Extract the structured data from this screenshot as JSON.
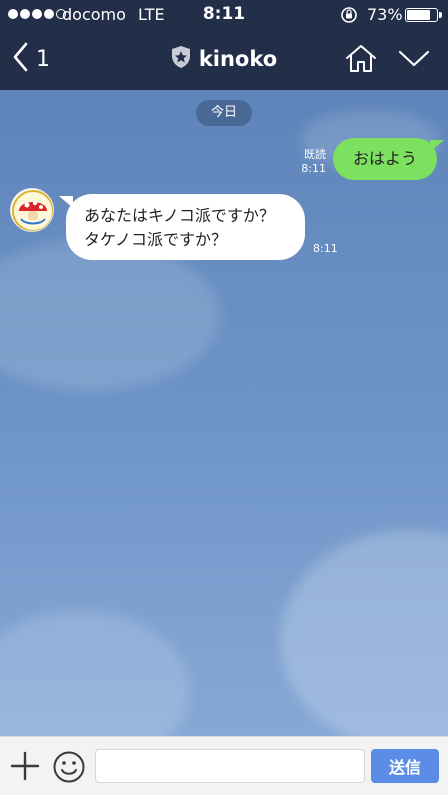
{
  "status_bar": {
    "carrier": "docomo",
    "network": "LTE",
    "time": "8:11",
    "battery_text": "73%",
    "battery_level": 0.73
  },
  "navbar": {
    "back_count": "1",
    "title": "kinoko"
  },
  "chat": {
    "date_label": "今日",
    "messages": [
      {
        "side": "sent",
        "text": "おはよう",
        "read_label": "既読",
        "time": "8:11"
      },
      {
        "side": "received",
        "lines": [
          "あなたはキノコ派ですか？",
          "タケノコ派ですか？"
        ],
        "time": "8:11"
      }
    ]
  },
  "input_bar": {
    "placeholder": "",
    "send_label": "送信"
  },
  "colors": {
    "header_bg": "#232f48",
    "sent_bubble": "#7be15e",
    "send_button": "#5b8ce6"
  },
  "icons": [
    "signal-icon",
    "back-chevron-icon",
    "official-badge-icon",
    "home-icon",
    "chevron-down-icon",
    "plus-icon",
    "emoji-icon",
    "avatar-mushroom-icon",
    "rotation-lock-icon",
    "battery-icon"
  ]
}
